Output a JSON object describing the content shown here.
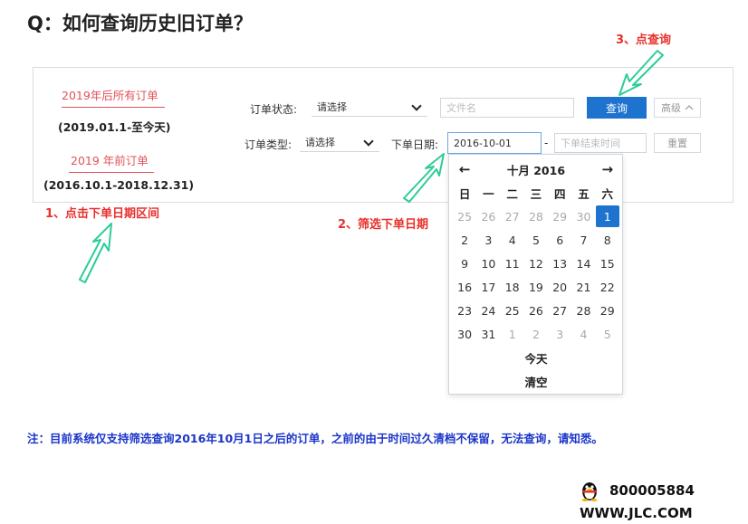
{
  "title": "Q：如何查询历史旧订单？",
  "steps": {
    "step1": "1、点击下单日期区间",
    "step2": "2、筛选下单日期",
    "step3": "3、点查询"
  },
  "sidebar": {
    "after2019_label": "2019年后所有订单",
    "after2019_range": "(2019.01.1-至今天)",
    "before2019_label": "2019 年前订单",
    "before2019_range": "(2016.10.1-2018.12.31)"
  },
  "filters": {
    "status_label": "订单状态:",
    "status_value": "请选择",
    "file_placeholder": "文件名",
    "query_button": "查询",
    "advanced_button": "高级",
    "type_label": "订单类型:",
    "type_value": "请选择",
    "date_label": "下单日期:",
    "date_start_value": "2016-10-01",
    "date_separator": "-",
    "date_end_placeholder": "下单结束时间",
    "reset_button": "重置"
  },
  "calendar": {
    "prev_arrow": "←",
    "month_title": "十月 2016",
    "next_arrow": "→",
    "weekdays": [
      "日",
      "一",
      "二",
      "三",
      "四",
      "五",
      "六"
    ],
    "weeks": [
      [
        "25",
        "26",
        "27",
        "28",
        "29",
        "30",
        "1"
      ],
      [
        "2",
        "3",
        "4",
        "5",
        "6",
        "7",
        "8"
      ],
      [
        "9",
        "10",
        "11",
        "12",
        "13",
        "14",
        "15"
      ],
      [
        "16",
        "17",
        "18",
        "19",
        "20",
        "21",
        "22"
      ],
      [
        "23",
        "24",
        "25",
        "26",
        "27",
        "28",
        "29"
      ],
      [
        "30",
        "31",
        "1",
        "2",
        "3",
        "4",
        "5"
      ]
    ],
    "selected_day": "1",
    "today_button": "今天",
    "clear_button": "清空"
  },
  "note": "注：目前系统仅支持筛选查询2016年10月1日之后的订单，之前的由于时间过久清档不保留，无法查询，请知悉。",
  "contact": {
    "qq_icon": "qq-penguin-icon",
    "qq_number": "800005884",
    "website": "WWW.JLC.COM"
  },
  "colors": {
    "accent_blue": "#1e73cf",
    "step_red": "#e8302c",
    "link_red": "#e0535a",
    "arrow_green": "#2ecc9a",
    "note_blue": "#1a35c9"
  }
}
